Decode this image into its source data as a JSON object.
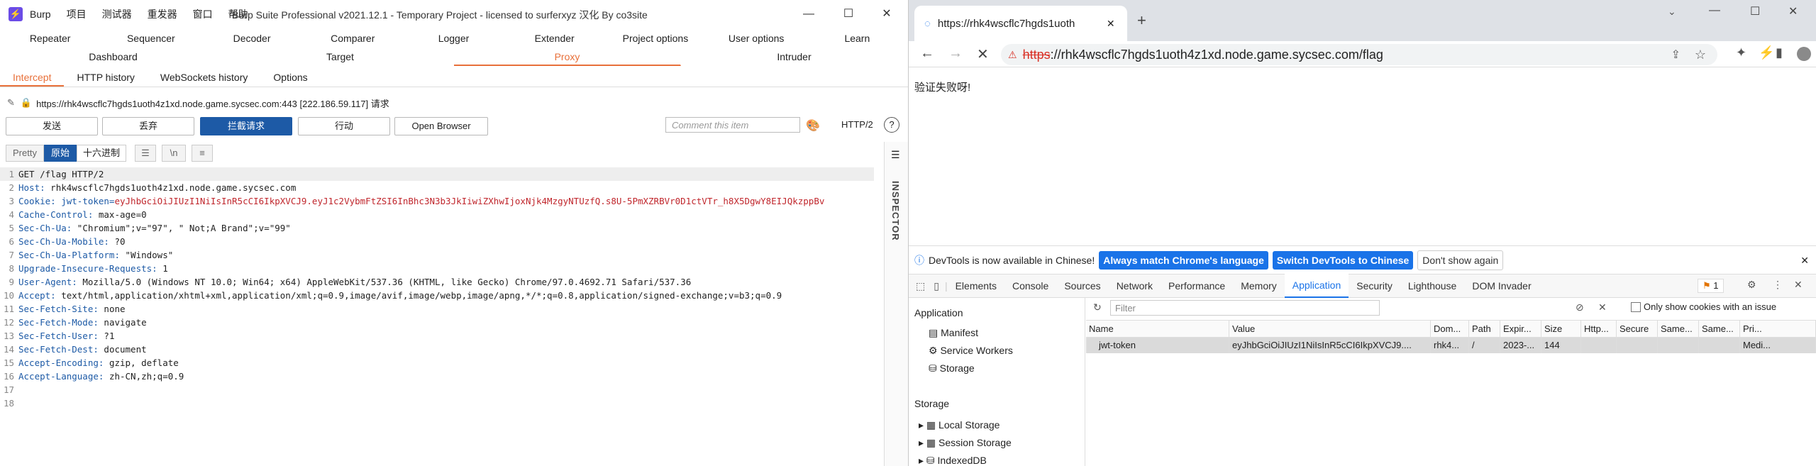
{
  "burp": {
    "menu": [
      "Burp",
      "项目",
      "测试器",
      "重发器",
      "窗口",
      "帮助"
    ],
    "title": "Burp Suite Professional v2021.12.1 - Temporary Project - licensed to surferxyz 汉化 By co3site",
    "tabs_row1": [
      "Repeater",
      "Sequencer",
      "Decoder",
      "Comparer",
      "Logger",
      "Extender",
      "Project options",
      "User options",
      "Learn"
    ],
    "tabs_row2": [
      "Dashboard",
      "Target",
      "Proxy",
      "Intruder"
    ],
    "subtabs": [
      "Intercept",
      "HTTP history",
      "WebSockets history",
      "Options"
    ],
    "request_target": "https://rhk4wscflc7hgds1uoth4z1xd.node.game.sycsec.com:443  [222.186.59.117] 请求",
    "buttons": {
      "forward": "发送",
      "drop": "丢弃",
      "intercept": "拦截请求",
      "action": "行动",
      "open_browser": "Open Browser"
    },
    "comment_placeholder": "Comment this item",
    "http_version": "HTTP/2",
    "view_buttons": {
      "pretty": "Pretty",
      "raw": "原始",
      "hex": "十六进制",
      "newline": "\\n"
    },
    "inspector": "INSPECTOR",
    "request_lines": [
      {
        "n": "1",
        "k": "",
        "v": "GET /flag HTTP/2"
      },
      {
        "n": "2",
        "k": "Host:",
        "v": " rhk4wscflc7hgds1uoth4z1xd.node.game.sycsec.com"
      },
      {
        "n": "3",
        "k": "Cookie: jwt-token=",
        "v": "eyJhbGciOiJIUzI1NiIsInR5cCI6IkpXVCJ9.eyJ1c2VybmFtZSI6InBhc3N3b3JkIiwiZXhwIjoxNjk4MzgyNTUzfQ.s8U-5PmXZRBVr0D1ctVTr_h8X5DgwY8EIJQkzppBv"
      },
      {
        "n": "4",
        "k": "Cache-Control:",
        "v": " max-age=0"
      },
      {
        "n": "5",
        "k": "Sec-Ch-Ua:",
        "v": " \"Chromium\";v=\"97\", \" Not;A Brand\";v=\"99\""
      },
      {
        "n": "6",
        "k": "Sec-Ch-Ua-Mobile:",
        "v": " ?0"
      },
      {
        "n": "7",
        "k": "Sec-Ch-Ua-Platform:",
        "v": " \"Windows\""
      },
      {
        "n": "8",
        "k": "Upgrade-Insecure-Requests:",
        "v": " 1"
      },
      {
        "n": "9",
        "k": "User-Agent:",
        "v": " Mozilla/5.0 (Windows NT 10.0; Win64; x64) AppleWebKit/537.36 (KHTML, like Gecko) Chrome/97.0.4692.71 Safari/537.36"
      },
      {
        "n": "10",
        "k": "Accept:",
        "v": " text/html,application/xhtml+xml,application/xml;q=0.9,image/avif,image/webp,image/apng,*/*;q=0.8,application/signed-exchange;v=b3;q=0.9"
      },
      {
        "n": "11",
        "k": "Sec-Fetch-Site:",
        "v": " none"
      },
      {
        "n": "12",
        "k": "Sec-Fetch-Mode:",
        "v": " navigate"
      },
      {
        "n": "13",
        "k": "Sec-Fetch-User:",
        "v": " ?1"
      },
      {
        "n": "14",
        "k": "Sec-Fetch-Dest:",
        "v": " document"
      },
      {
        "n": "15",
        "k": "Accept-Encoding:",
        "v": " gzip, deflate"
      },
      {
        "n": "16",
        "k": "Accept-Language:",
        "v": " zh-CN,zh;q=0.9"
      },
      {
        "n": "17",
        "k": "",
        "v": ""
      },
      {
        "n": "18",
        "k": "",
        "v": ""
      }
    ]
  },
  "chrome": {
    "tab_title": "https://rhk4wscflc7hgds1uoth",
    "url_scheme": "https",
    "url_rest": "://rhk4wscflc7hgds1uoth4z1xd.node.game.sycsec.com/flag",
    "page_text": "验证失败呀!",
    "infobar": {
      "text": "DevTools is now available in Chinese!",
      "btn1": "Always match Chrome's language",
      "btn2": "Switch DevTools to Chinese",
      "btn3": "Don't show again"
    },
    "devtools_tabs": [
      "Elements",
      "Console",
      "Sources",
      "Network",
      "Performance",
      "Memory",
      "Application",
      "Security",
      "Lighthouse",
      "DOM Invader"
    ],
    "issues_count": "1",
    "sidebar": {
      "application_header": "Application",
      "items": [
        "Manifest",
        "Service Workers",
        "Storage"
      ],
      "storage_header": "Storage",
      "storage_items": [
        "Local Storage",
        "Session Storage",
        "IndexedDB"
      ]
    },
    "filter_placeholder": "Filter",
    "only_issues_label": "Only show cookies with an issue",
    "cookie_columns": [
      "Name",
      "Value",
      "Dom...",
      "Path",
      "Expir...",
      "Size",
      "Http...",
      "Secure",
      "Same...",
      "Same...",
      "Pri..."
    ],
    "cookie_row": [
      "jwt-token",
      "eyJhbGciOiJIUzI1NiIsInR5cCI6IkpXVCJ9....",
      "rhk4...",
      "/",
      "2023-...",
      "144",
      "",
      "",
      "",
      "",
      "Medi..."
    ]
  }
}
